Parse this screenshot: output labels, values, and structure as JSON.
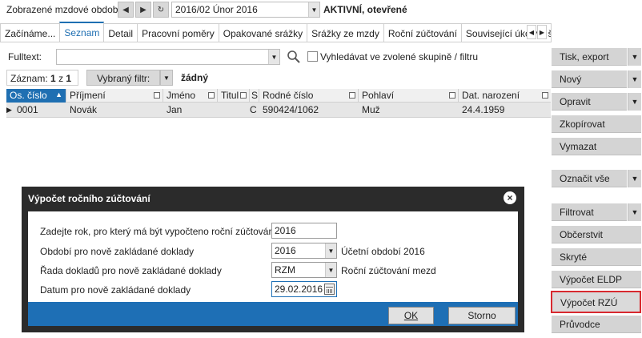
{
  "period": {
    "label": "Zobrazené mzdové období:",
    "value": "2016/02 Únor 2016",
    "status": "AKTIVNÍ, otevřené"
  },
  "tabs": [
    {
      "label": "Začínáme..."
    },
    {
      "label": "Seznam"
    },
    {
      "label": "Detail"
    },
    {
      "label": "Pracovní poměry"
    },
    {
      "label": "Opakované srážky"
    },
    {
      "label": "Srážky ze mzdy"
    },
    {
      "label": "Roční zúčtování"
    },
    {
      "label": "Související úkoly a škole"
    }
  ],
  "filter": {
    "fulltext_label": "Fulltext:",
    "fulltext_value": "",
    "group_search_label": "Vyhledávat ve zvolené skupině / filtru",
    "records_label": "Záznam:",
    "records_current": "1",
    "records_sep": "z",
    "records_total": "1",
    "selected_filter_label": "Vybraný filtr:",
    "selected_filter_value": "žádný"
  },
  "grid": {
    "columns": [
      "Os. číslo",
      "Příjmení",
      "Jméno",
      "Titul",
      "S",
      "Rodné číslo",
      "Pohlaví",
      "Dat. narození"
    ],
    "rows": [
      {
        "os_cislo": "0001",
        "prijmeni": "Novák",
        "jmeno": "Jan",
        "titul": "",
        "s": "C",
        "rodne_cislo": "590424/1062",
        "pohlavi": "Muž",
        "dat_narozeni": "24.4.1959"
      }
    ]
  },
  "side_panel": {
    "tisk_export": "Tisk, export",
    "novy": "Nový",
    "opravit": "Opravit",
    "zkopirovat": "Zkopírovat",
    "vymazat": "Vymazat",
    "oznacit_vse": "Označit vše",
    "filtrovat": "Filtrovat",
    "obcerstvit": "Občerstvit",
    "skryte": "Skryté",
    "vypocet_eldp": "Výpočet ELDP",
    "vypocet_rzu": "Výpočet RZÚ",
    "pruvodce": "Průvodce"
  },
  "modal": {
    "title": "Výpočet ročního zúčtování",
    "year_label": "Zadejte rok, pro který má být vypočteno roční zúčtování:",
    "year_value": "2016",
    "period_label": "Období pro nově zakládané doklady",
    "period_value": "2016",
    "period_note": "Účetní období 2016",
    "series_label": "Řada dokladů pro nově zakládané doklady",
    "series_value": "RZM",
    "series_note": "Roční zúčtování mezd",
    "date_label": "Datum pro nově zakládané doklady",
    "date_value": "29.02.2016",
    "ok_label": "OK",
    "cancel_label": "Storno"
  },
  "colors": {
    "accent": "#1f6fb2",
    "modal_header": "#2b2b2b",
    "highlight": "#d8292f"
  }
}
